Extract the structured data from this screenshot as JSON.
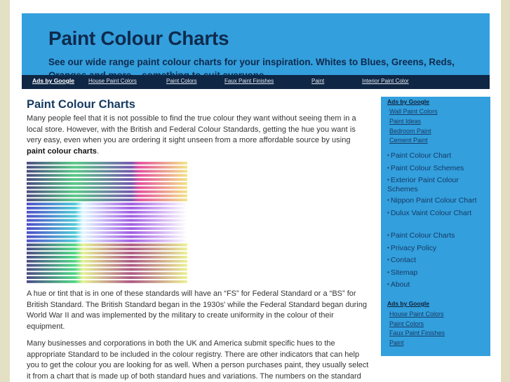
{
  "header": {
    "title": "Paint Colour Charts",
    "tagline": "See our wide range paint colour charts for your inspiration. Whites to Blues, Greens, Reds, Oranges and more – something to suit everyone"
  },
  "ad_bar": {
    "label": "Ads by Google",
    "links": [
      "House Paint Colors",
      "Paint Colors",
      "Faux Paint Finishes",
      "Paint",
      "Interior Paint Color"
    ]
  },
  "main": {
    "heading": "Paint Colour Charts",
    "p1_text": "Many people feel that it is not possible to find the true colour they want without seeing them in a local store. However, with the British and Federal Colour Standards, getting the hue you want is very easy, even when you are ordering it sight unseen from a more affordable source by using ",
    "p1_bold": "paint colour charts",
    "p1_end": ".",
    "p2": "A hue or tint that is in one of these standards will have an “FS” for Federal Standard or a “BS” for British Standard. The British Standard began in the 1930s' while the Federal Standard began during World War II and was implemented by the military to create uniformity in the colour of their equipment.",
    "p3": "Many businesses and corporations in both the UK and America submit specific hues to the appropriate Standard to be included in the colour registry. There are other indicators that can help you to get the colour you are looking for as well. When a person purchases paint, they usually select it from a chart that is made up of both standard hues and variations. The numbers on the standard",
    "image_alt": "colour swatch chart"
  },
  "sidebar": {
    "ads1_label": "Ads by Google",
    "ads1_links": [
      "Wall Paint Colors",
      "Paint Ideas",
      "Bedroom Paint",
      "Cement Paint"
    ],
    "links1": [
      "Paint Colour Chart",
      "Paint Colour Schemes",
      "Exterior Paint Colour Schemes",
      "Nippon Paint Colour Chart",
      "Dulux Vaint Colour Chart"
    ],
    "links2": [
      "Paint Colour Charts",
      "Privacy Policy",
      "Contact",
      "Sitemap",
      "About"
    ],
    "ads2_label": "Ads by Google",
    "ads2_links": [
      "House Paint Colors",
      "Paint Colors",
      "Faux Paint Finishes",
      "Paint"
    ],
    "bullet": "•"
  },
  "colors": {
    "header_bg": "#339fdd",
    "nav_bg": "#0f2645",
    "title": "#0f2a4d",
    "page_bg": "#e4e0c4"
  }
}
